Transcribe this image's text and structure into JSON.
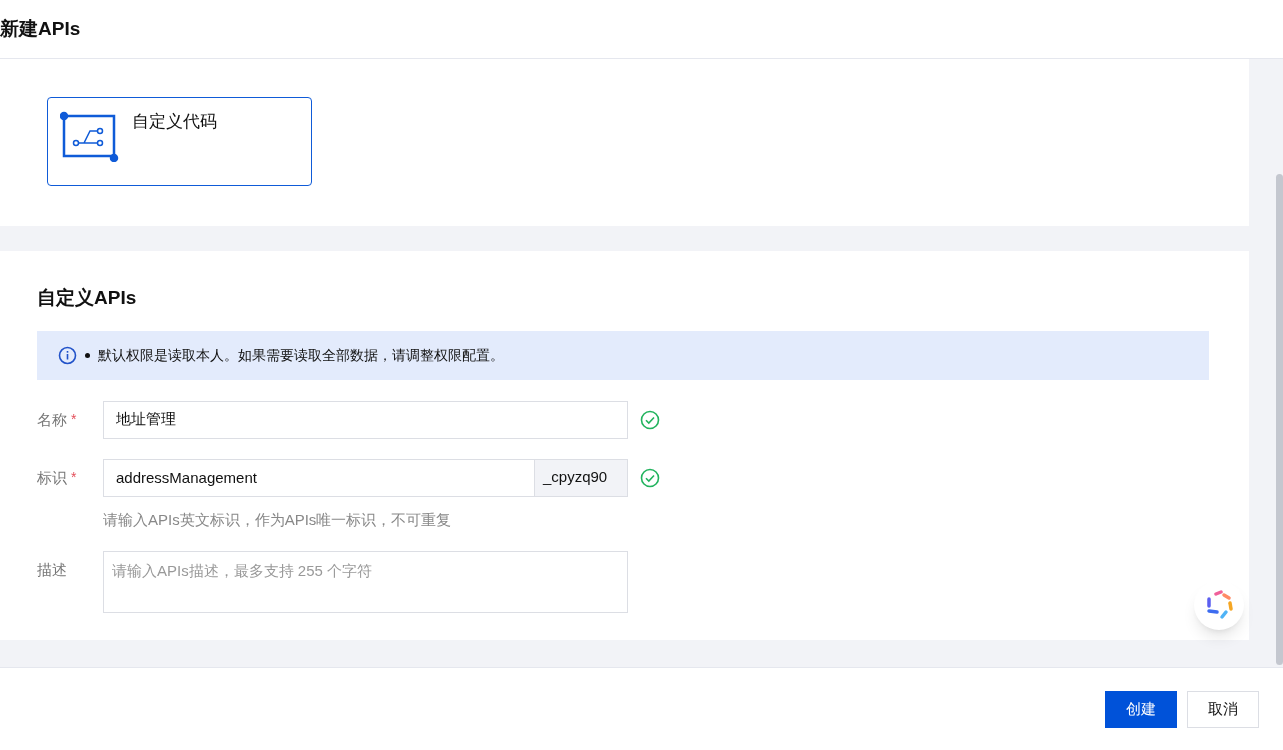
{
  "window": {
    "title": "新建APIs"
  },
  "templates": [
    {
      "label": "自定义代码",
      "selected": true
    }
  ],
  "section": {
    "title": "自定义APIs",
    "notice": "默认权限是读取本人。如果需要读取全部数据，请调整权限配置。"
  },
  "fields": [
    {
      "kind": "text",
      "label": "名称",
      "required": true,
      "required_mark": "*",
      "value": "地址管理",
      "valid": true
    },
    {
      "kind": "suffix",
      "label": "标识",
      "required": true,
      "required_mark": "*",
      "value": "addressManagement",
      "suffix": "_cpyzq90",
      "valid": true,
      "hint": "请输入APIs英文标识，作为APIs唯一标识，不可重复"
    },
    {
      "kind": "textarea",
      "label": "描述",
      "placeholder": "请输入APIs描述，最多支持 255 个字符"
    }
  ],
  "buttons": [
    {
      "label": "创建",
      "kind": "primary"
    },
    {
      "label": "取消",
      "kind": "default"
    }
  ]
}
